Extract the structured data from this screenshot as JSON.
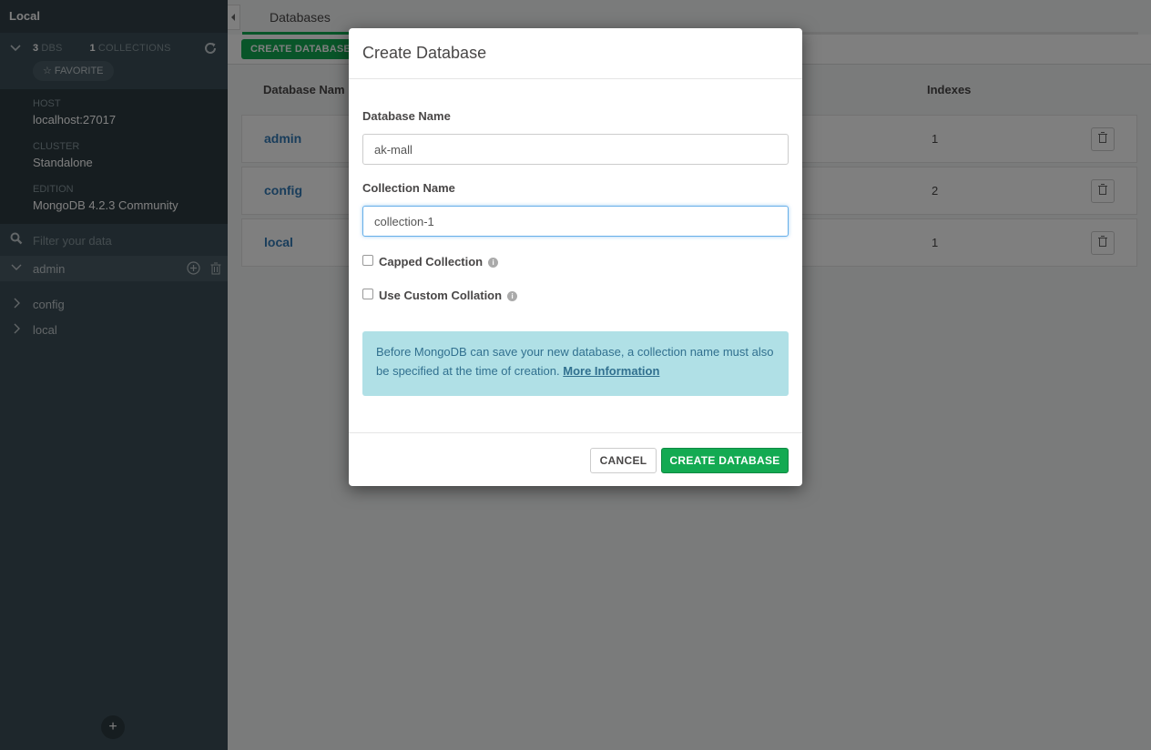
{
  "sidebar": {
    "title": "Local",
    "stats": {
      "dbs_count": "3",
      "dbs_label": "DBS",
      "collections_count": "1",
      "collections_label": "COLLECTIONS"
    },
    "favorite_label": "☆ FAVORITE",
    "host": {
      "label": "HOST",
      "value": "localhost:27017"
    },
    "cluster": {
      "label": "CLUSTER",
      "value": "Standalone"
    },
    "edition": {
      "label": "EDITION",
      "value": "MongoDB 4.2.3 Community"
    },
    "filter_placeholder": "Filter your data",
    "databases": [
      {
        "label": "admin",
        "expanded": true
      },
      {
        "label": "config",
        "expanded": false
      },
      {
        "label": "local",
        "expanded": false
      }
    ],
    "add_label": "+"
  },
  "main": {
    "tab_label": "Databases",
    "create_button": "CREATE DATABASE",
    "columns": {
      "name": "Database Nam",
      "indexes": "Indexes"
    },
    "rows": [
      {
        "name": "admin",
        "indexes": "1"
      },
      {
        "name": "config",
        "indexes": "2"
      },
      {
        "name": "local",
        "indexes": "1"
      }
    ]
  },
  "modal": {
    "title": "Create Database",
    "db_name_label": "Database Name",
    "db_name_value": "ak-mall",
    "collection_name_label": "Collection Name",
    "collection_name_value": "collection-1",
    "capped_label": "Capped Collection",
    "custom_collation_label": "Use Custom Collation",
    "info_text": "Before MongoDB can save your new database, a collection name must also be specified at the time of creation.",
    "info_link": "More Information",
    "cancel_button": "CANCEL",
    "create_button": "CREATE DATABASE"
  },
  "colors": {
    "accent_green": "#13aa52",
    "sidebar_bg": "#3d4f58",
    "link_blue": "#337ab7",
    "info_bg": "#b0e0e6"
  }
}
